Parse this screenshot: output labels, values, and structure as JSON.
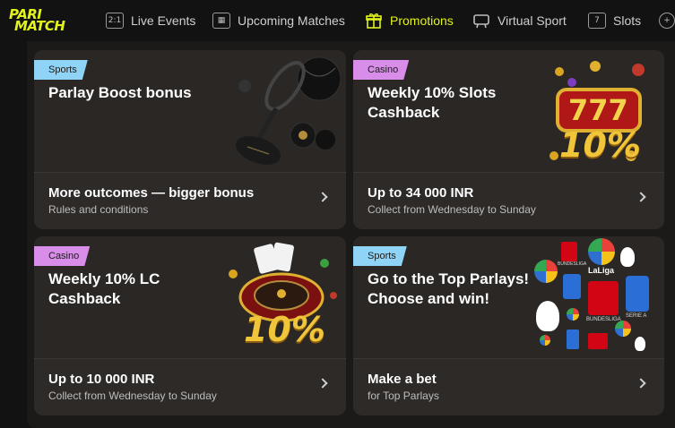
{
  "brand": {
    "logo_line1": "PARI",
    "logo_line2": "MATCH",
    "accent": "#e2f21d"
  },
  "nav": {
    "items": [
      {
        "label": "Live Events",
        "icon": "scoreboard-icon",
        "icon_text": "2:1"
      },
      {
        "label": "Upcoming Matches",
        "icon": "calendar-icon",
        "icon_text": "▦"
      },
      {
        "label": "Promotions",
        "icon": "gift-icon",
        "icon_text": "🎁",
        "active": true
      },
      {
        "label": "Virtual Sport",
        "icon": "gamepad-icon",
        "icon_text": "◫"
      },
      {
        "label": "Slots",
        "icon": "slot-icon",
        "icon_text": "7"
      }
    ]
  },
  "promos": [
    {
      "tag": "Sports",
      "tag_color": "#8fd4f7",
      "title": "Parlay Boost bonus",
      "footer_main": "More outcomes — bigger bonus",
      "footer_sub": "Rules and conditions"
    },
    {
      "tag": "Casino",
      "tag_color": "#d88ee8",
      "title": "Weekly 10% Slots Cashback",
      "footer_main": "Up to 34 000 INR",
      "footer_sub": "Collect from Wednesday to Sunday",
      "art_text_1": "777",
      "art_text_2": "10%"
    },
    {
      "tag": "Casino",
      "tag_color": "#d88ee8",
      "title": "Weekly 10% LC Cashback",
      "footer_main": "Up to 10 000 INR",
      "footer_sub": "Collect from Wednesday to Sunday",
      "art_text_1": "10%"
    },
    {
      "tag": "Sports",
      "tag_color": "#8fd4f7",
      "title": "Go to the Top Parlays! Choose and win!",
      "footer_main": "Make a bet",
      "footer_sub": "for Top Parlays",
      "leagues": [
        "BUNDESLIGA",
        "LaLiga",
        "SERIE A",
        "LaLiga",
        "BUNDESLIGA",
        "SERIE A",
        "LaLiga",
        "LaLiga",
        "SERIE A",
        "BUNDESLIGA"
      ]
    }
  ]
}
